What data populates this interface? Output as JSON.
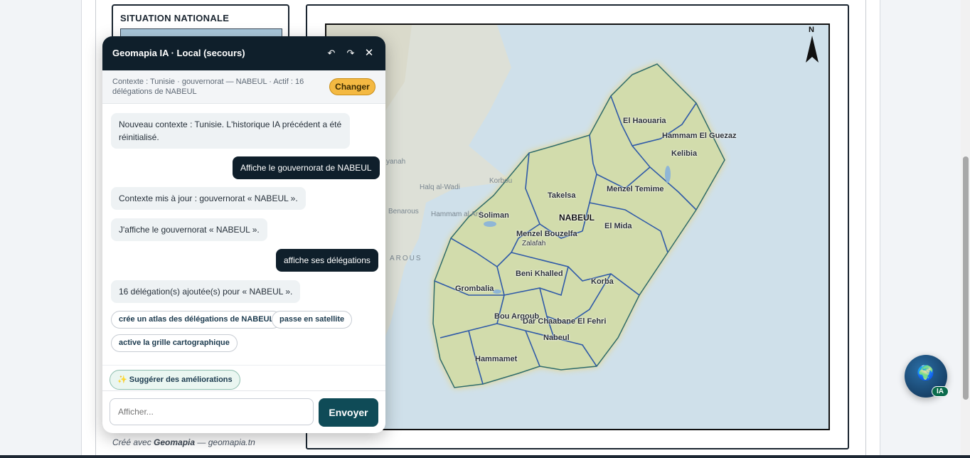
{
  "situation": {
    "title": "SITUATION NATIONALE"
  },
  "map": {
    "north_label": "N",
    "region_label": "NABEUL",
    "delegations": [
      "El Haouaria",
      "Hammam El Guezaz",
      "Kelibia",
      "Takelsa",
      "Menzel Temime",
      "Soliman",
      "Menzel Bouzelfa",
      "El Mida",
      "Zalafah",
      "Beni Khalled",
      "Korba",
      "Grombalia",
      "Bou Argoub",
      "Dar Chaabane El Fehri",
      "Nabeul",
      "Hammamet"
    ],
    "background_labels": [
      "Halq al-Wadi",
      "Benarous",
      "Hammam al Anf",
      "AROUS",
      "yanah",
      "Korbou"
    ],
    "colors": {
      "sea": "#cfe0ea",
      "land": "#d7e1b4",
      "outline": "#2f5aa8",
      "halo": "#f0d36a"
    }
  },
  "footer": {
    "prefix": "Créé avec ",
    "brand": "Geomapia",
    "suffix": " — geomapia.tn"
  },
  "chat": {
    "title": "Geomapia IA · Local (secours)",
    "context": "Contexte : Tunisie · gouvernorat — NABEUL · Actif : 16 délégations de NABEUL",
    "change_label": "Changer",
    "messages": [
      {
        "role": "bot",
        "text": "Nouveau contexte : Tunisie. L'historique IA précédent a été réinitialisé."
      },
      {
        "role": "user",
        "text": "Affiche le gouvernorat de NABEUL"
      },
      {
        "role": "bot",
        "text": "Contexte mis à jour : gouvernorat « NABEUL »."
      },
      {
        "role": "bot",
        "text": "J'affiche le gouvernorat « NABEUL »."
      },
      {
        "role": "user",
        "text": "affiche ses délégations"
      },
      {
        "role": "bot",
        "text": "16 délégation(s) ajoutée(s) pour « NABEUL »."
      }
    ],
    "chips": [
      "crée un atlas des délégations de NABEUL",
      "passe en satellite",
      "active la grille cartographique"
    ],
    "suggest_label": "✨ Suggérer des améliorations",
    "input_placeholder": "Afficher...",
    "send_label": "Envoyer"
  },
  "fab": {
    "badge": "IA"
  }
}
